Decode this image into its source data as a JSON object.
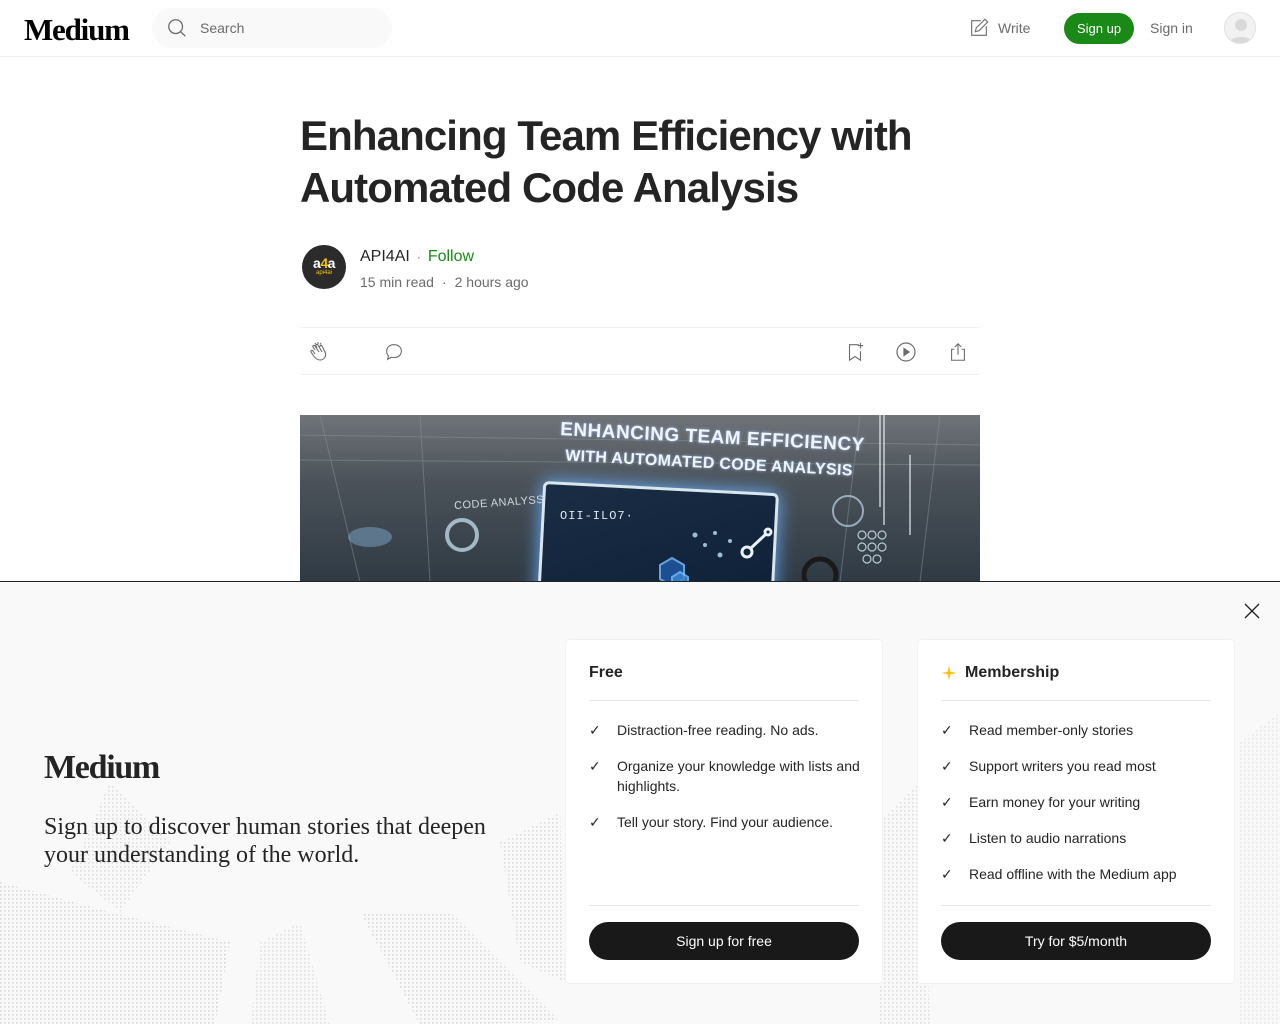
{
  "header": {
    "logo": "Medium",
    "search_placeholder": "Search",
    "write_label": "Write",
    "signup_label": "Sign up",
    "signin_label": "Sign in"
  },
  "article": {
    "title": "Enhancing Team Efficiency with Automated Code Analysis",
    "author": {
      "name": "API4AI",
      "avatar_mark": "a4a",
      "avatar_sub": "api4ai",
      "follow_label": "Follow"
    },
    "read_time": "15 min read",
    "published": "2 hours ago",
    "hero_image": {
      "headline_line1": "ENHANCING TEAM EFFICIENCY",
      "headline_line2": "WITH AUTOMATED CODE ANALYSIS",
      "side_label": "CODE ANALYSS",
      "screen_code": "OII-ILO7·"
    }
  },
  "signup_overlay": {
    "logo": "Medium",
    "tagline": "Sign up to discover human stories that deepen your understanding of the world.",
    "free": {
      "title": "Free",
      "features": [
        "Distraction-free reading. No ads.",
        "Organize your knowledge with lists and highlights.",
        "Tell your story. Find your audience."
      ],
      "button": "Sign up for free"
    },
    "membership": {
      "title": "Membership",
      "features": [
        "Read member-only stories",
        "Support writers you read most",
        "Earn money for your writing",
        "Listen to audio narrations",
        "Read offline with the Medium app"
      ],
      "button": "Try for $5/month"
    }
  },
  "colors": {
    "brand_green": "#1a8917",
    "text_primary": "#242424",
    "text_secondary": "#6b6b6b",
    "button_dark": "#191919",
    "membership_star": "#ffc017"
  },
  "icons": {
    "search": "search-icon",
    "write": "write-icon",
    "clap": "clap-icon",
    "comment": "comment-icon",
    "bookmark": "bookmark-add-icon",
    "listen": "play-icon",
    "share": "share-icon",
    "close": "close-icon",
    "check": "check-icon",
    "star": "star-icon"
  }
}
